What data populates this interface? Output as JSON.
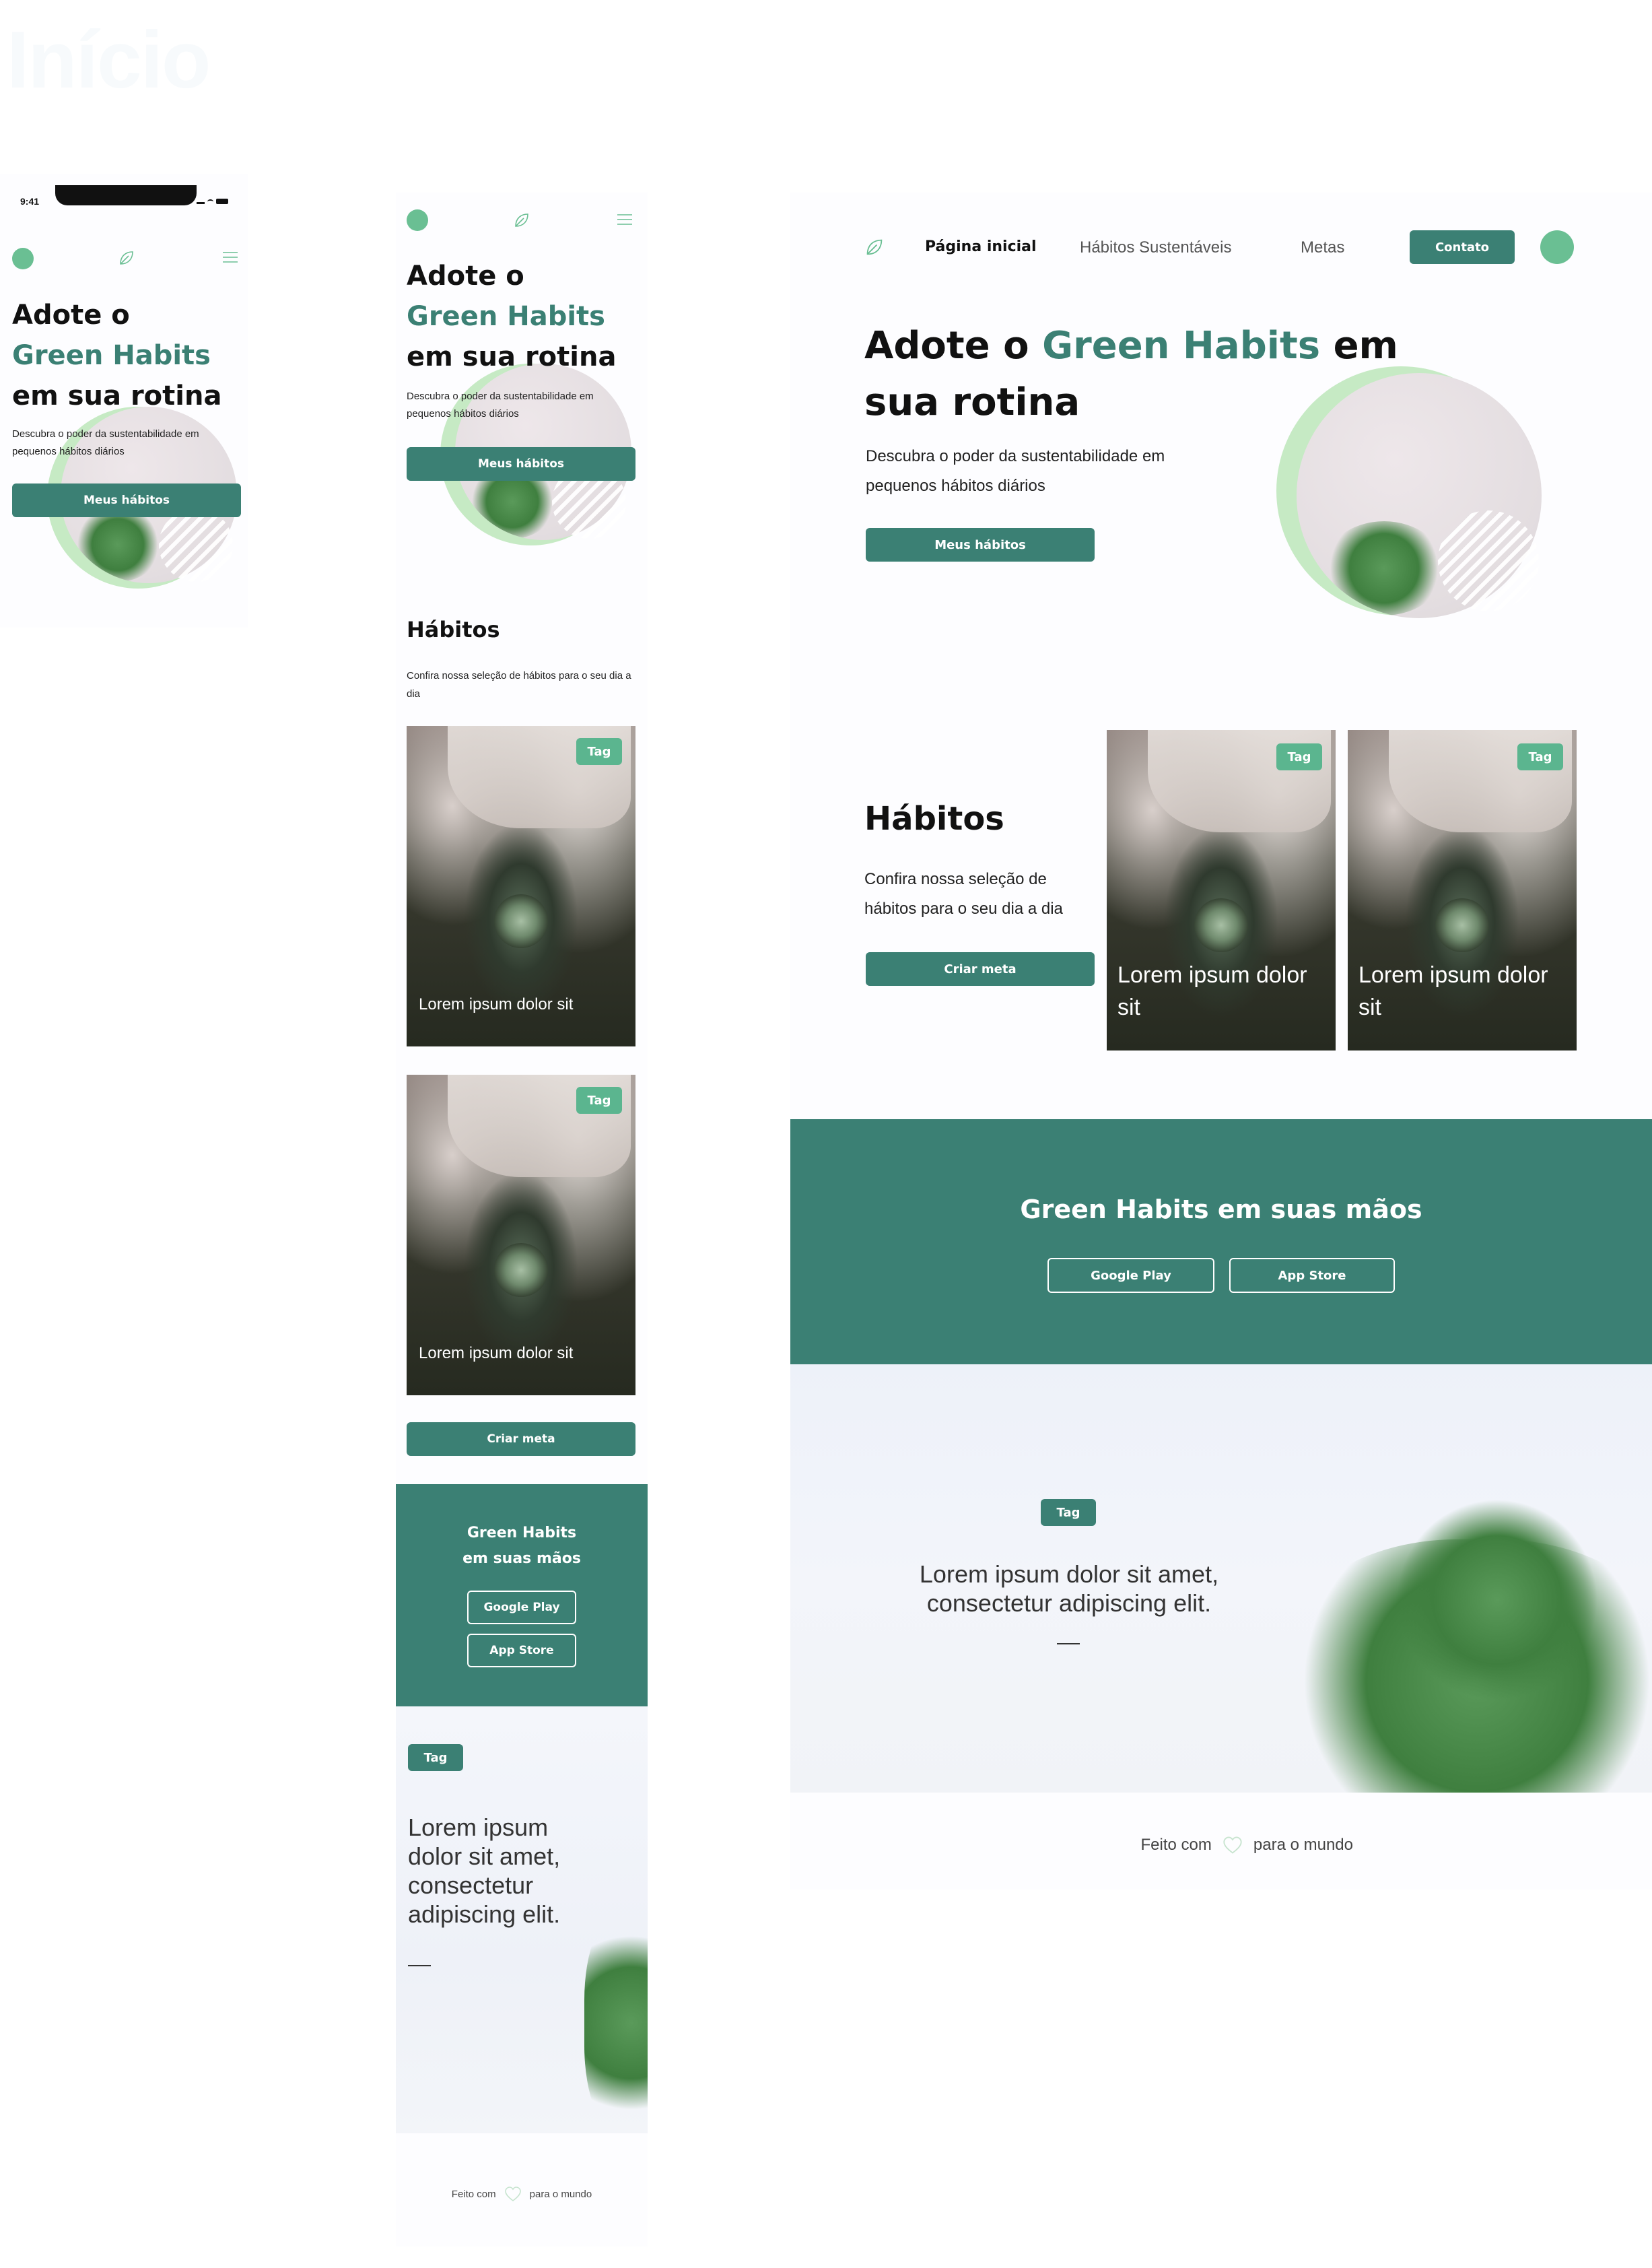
{
  "page": {
    "title": "Início"
  },
  "mobile": {
    "status": {
      "time": "9:41"
    },
    "hero": {
      "line1": "Adote o",
      "line2": "Green Habits",
      "line3": "em sua rotina",
      "description": "Descubra o poder da sustentabilidade em pequenos hábitos diários",
      "cta": "Meus hábitos"
    }
  },
  "tablet": {
    "hero": {
      "line1": "Adote o",
      "line2": "Green Habits",
      "line3": "em sua rotina",
      "description": "Descubra o poder da sustentabilidade em pequenos hábitos diários",
      "cta": "Meus hábitos"
    },
    "habits": {
      "title": "Hábitos",
      "description": "Confira nossa seleção de hábitos para o seu dia a dia",
      "cards": [
        {
          "tag": "Tag",
          "caption": "Lorem ipsum dolor sit"
        },
        {
          "tag": "Tag",
          "caption": "Lorem ipsum dolor sit"
        }
      ],
      "cta": "Criar meta"
    },
    "apps": {
      "title_line1": "Green Habits",
      "title_line2": "em suas mãos",
      "google_play": "Google Play",
      "app_store": "App Store"
    },
    "quote": {
      "tag": "Tag",
      "text_lines": [
        "Lorem ipsum",
        "dolor sit amet,",
        "consectetur",
        "adipiscing elit."
      ]
    },
    "footer": {
      "before": "Feito com",
      "after": "para o mundo"
    }
  },
  "desktop": {
    "nav": {
      "items": [
        "Página inicial",
        "Hábitos Sustentáveis",
        "Metas"
      ],
      "contact": "Contato"
    },
    "hero": {
      "part1": "Adote o ",
      "part2": "Green Habits",
      "part3": " em",
      "line2": "sua rotina",
      "description_line1": "Descubra o poder da sustentabilidade em",
      "description_line2": "pequenos hábitos diários",
      "cta": "Meus hábitos"
    },
    "habits": {
      "title": "Hábitos",
      "description_line1": "Confira nossa seleção de",
      "description_line2": "hábitos para o seu dia a dia",
      "cta": "Criar meta",
      "cards": [
        {
          "tag": "Tag",
          "caption_line1": "Lorem ipsum dolor",
          "caption_line2": "sit"
        },
        {
          "tag": "Tag",
          "caption_line1": "Lorem ipsum dolor",
          "caption_line2": "sit"
        }
      ]
    },
    "apps": {
      "title": "Green Habits em suas mãos",
      "google_play": "Google Play",
      "app_store": "App Store"
    },
    "quote": {
      "tag": "Tag",
      "line1": "Lorem ipsum dolor sit amet,",
      "line2": "consectetur adipiscing elit."
    },
    "footer": {
      "before": "Feito com",
      "after": "para o mundo"
    }
  },
  "colors": {
    "primary": "#3b8074",
    "accent": "#6abf93",
    "tag": "#5bb58f",
    "ring": "#c6eac4"
  },
  "icons": [
    "leaf-icon",
    "menu-icon",
    "heart-icon",
    "signal-icon",
    "wifi-icon",
    "battery-icon"
  ]
}
